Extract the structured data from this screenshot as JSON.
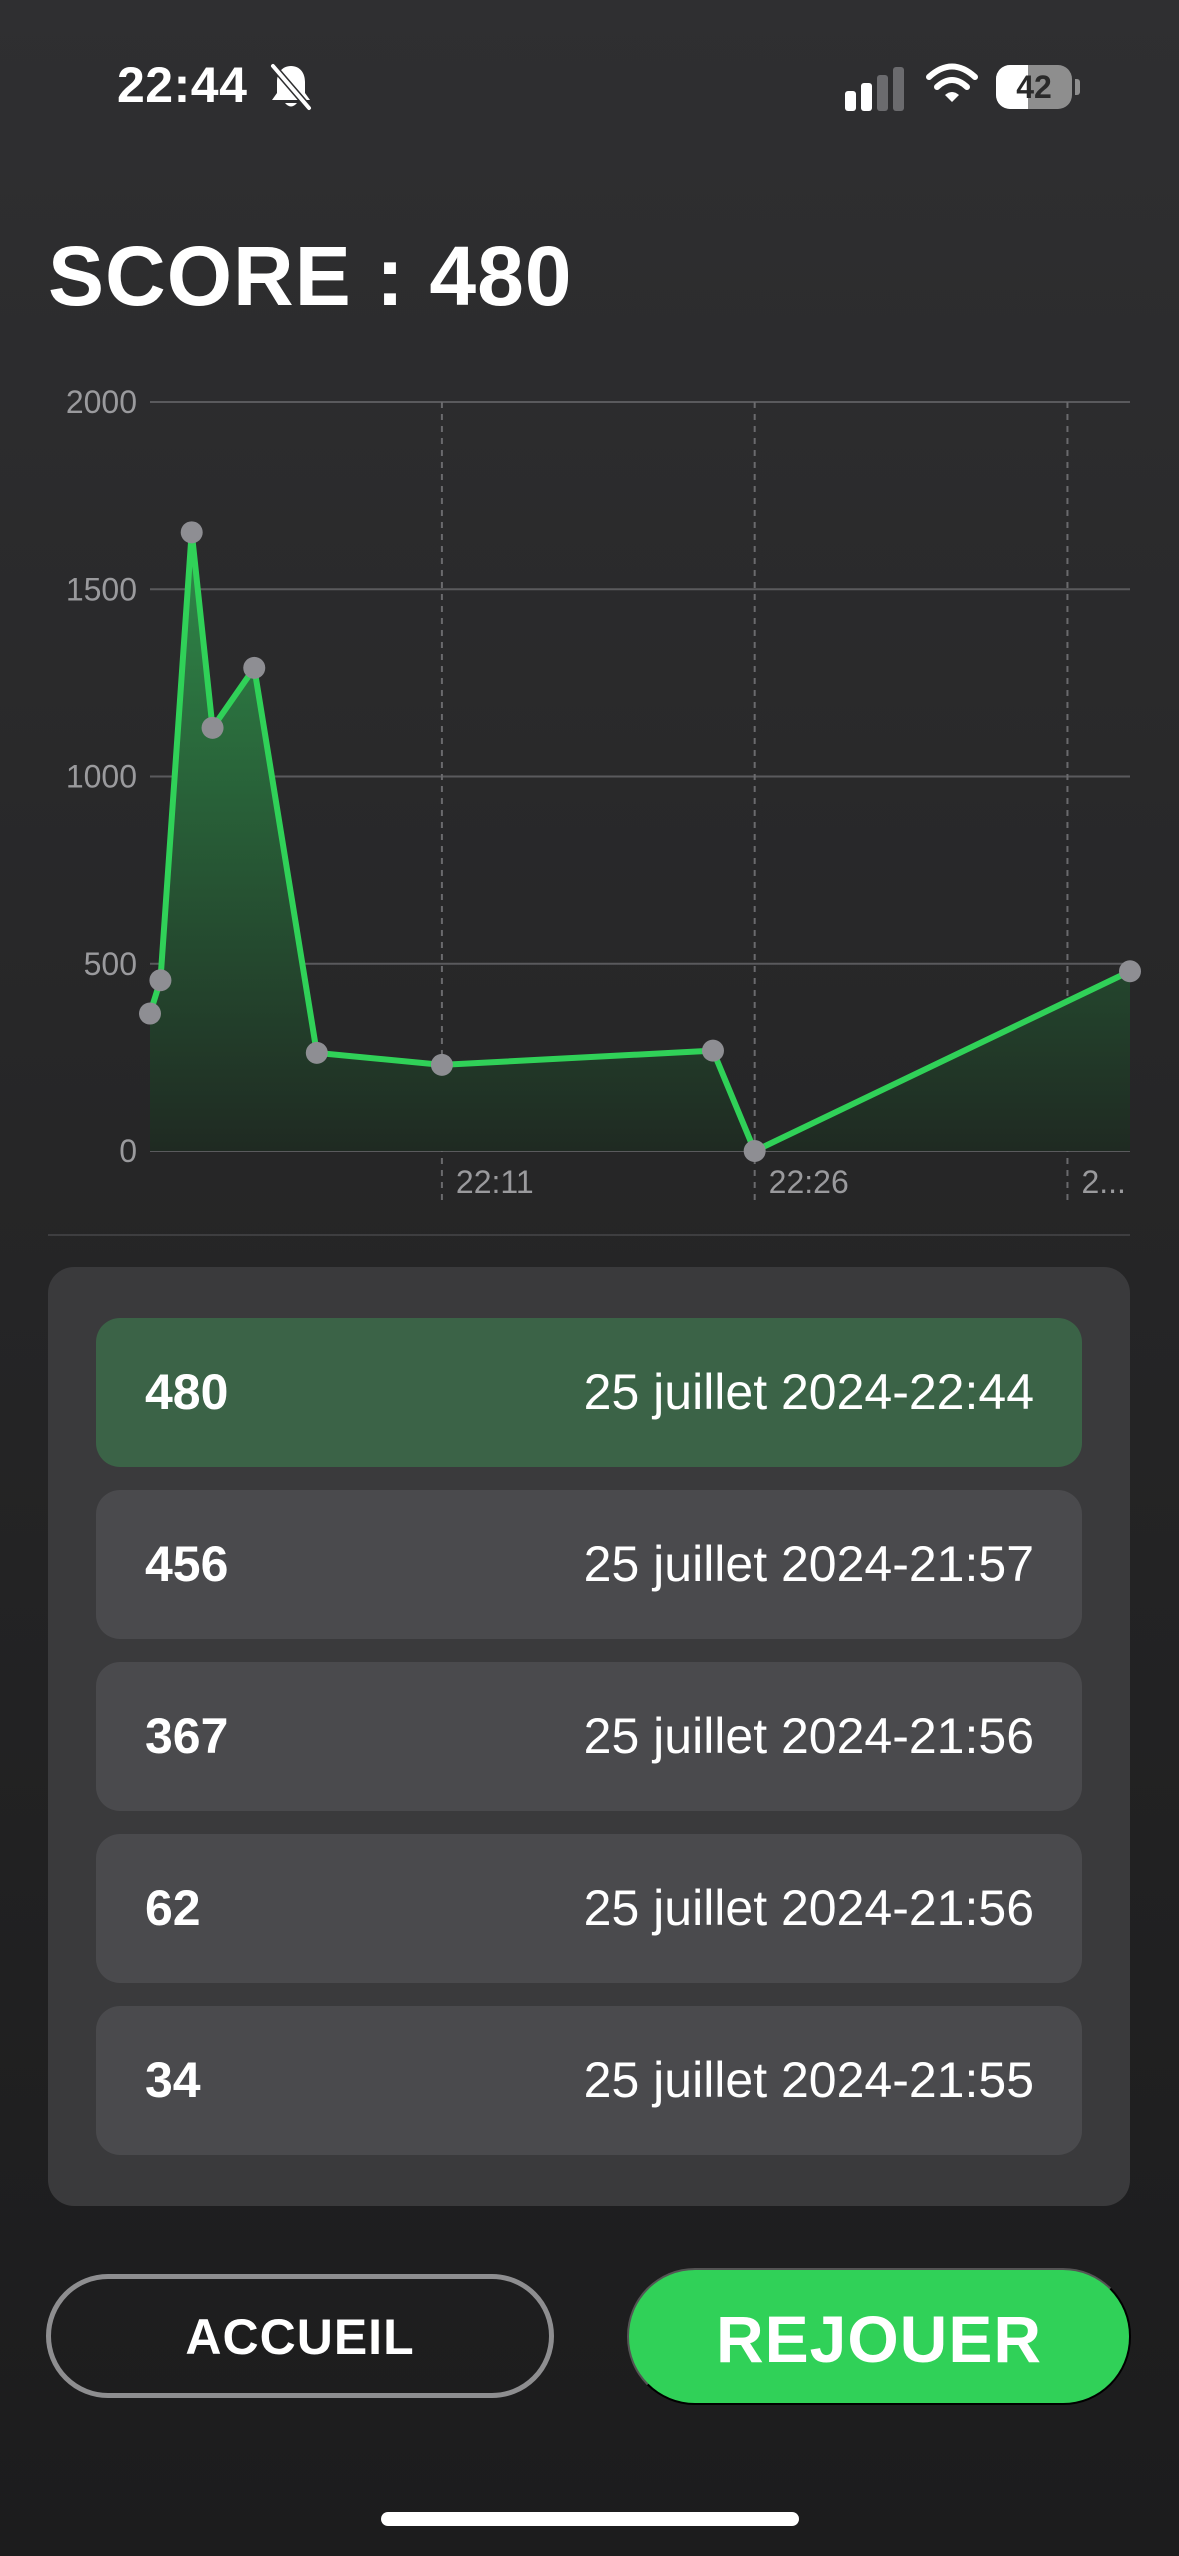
{
  "status_bar": {
    "time": "22:44",
    "icons": [
      "bell-slash-icon",
      "cellular-signal-icon",
      "wifi-icon",
      "battery-icon"
    ],
    "battery": {
      "text": "42",
      "level": 0.42
    }
  },
  "header": {
    "title": "SCORE : 480"
  },
  "chart_data": {
    "type": "area",
    "title": "",
    "xlabel": "",
    "ylabel": "",
    "ylim": [
      0,
      2000
    ],
    "yticks": [
      "0",
      "500",
      "1000",
      "1500",
      "2000"
    ],
    "xticks": [
      {
        "label": "22:11",
        "x": "22:11"
      },
      {
        "label": "22:26",
        "x": "22:26"
      },
      {
        "label": "2...",
        "x": "22:41"
      }
    ],
    "xlim": [
      "21:57",
      "22:44"
    ],
    "grid": true,
    "colors": {
      "line": "#30d158",
      "marker": "#8e8e93",
      "fill_top": "#2f8a49",
      "fill_bottom": "#1f2a22"
    },
    "series": [
      {
        "points": [
          {
            "x": "21:57",
            "y": 367
          },
          {
            "x": "21:57.5",
            "y": 456
          },
          {
            "x": "21:59",
            "y": 1652
          },
          {
            "x": "22:00",
            "y": 1130
          },
          {
            "x": "22:02",
            "y": 1290
          },
          {
            "x": "22:05",
            "y": 262
          },
          {
            "x": "22:11",
            "y": 230
          },
          {
            "x": "22:24",
            "y": 268
          },
          {
            "x": "22:26",
            "y": 0
          },
          {
            "x": "22:44",
            "y": 480
          }
        ]
      }
    ]
  },
  "history": {
    "rows": [
      {
        "score": "480",
        "date": "25 juillet 2024-22:44",
        "current": true
      },
      {
        "score": "456",
        "date": "25 juillet 2024-21:57",
        "current": false
      },
      {
        "score": "367",
        "date": "25 juillet 2024-21:56",
        "current": false
      },
      {
        "score": "62",
        "date": "25 juillet 2024-21:56",
        "current": false
      },
      {
        "score": "34",
        "date": "25 juillet 2024-21:55",
        "current": false
      }
    ]
  },
  "buttons": {
    "home_label": "ACCUEIL",
    "replay_label": "REJOUER"
  },
  "colors": {
    "accent": "#30d158",
    "highlight_row": "#3b6347",
    "row": "#4a4a4d",
    "card": "#3a3a3c"
  }
}
